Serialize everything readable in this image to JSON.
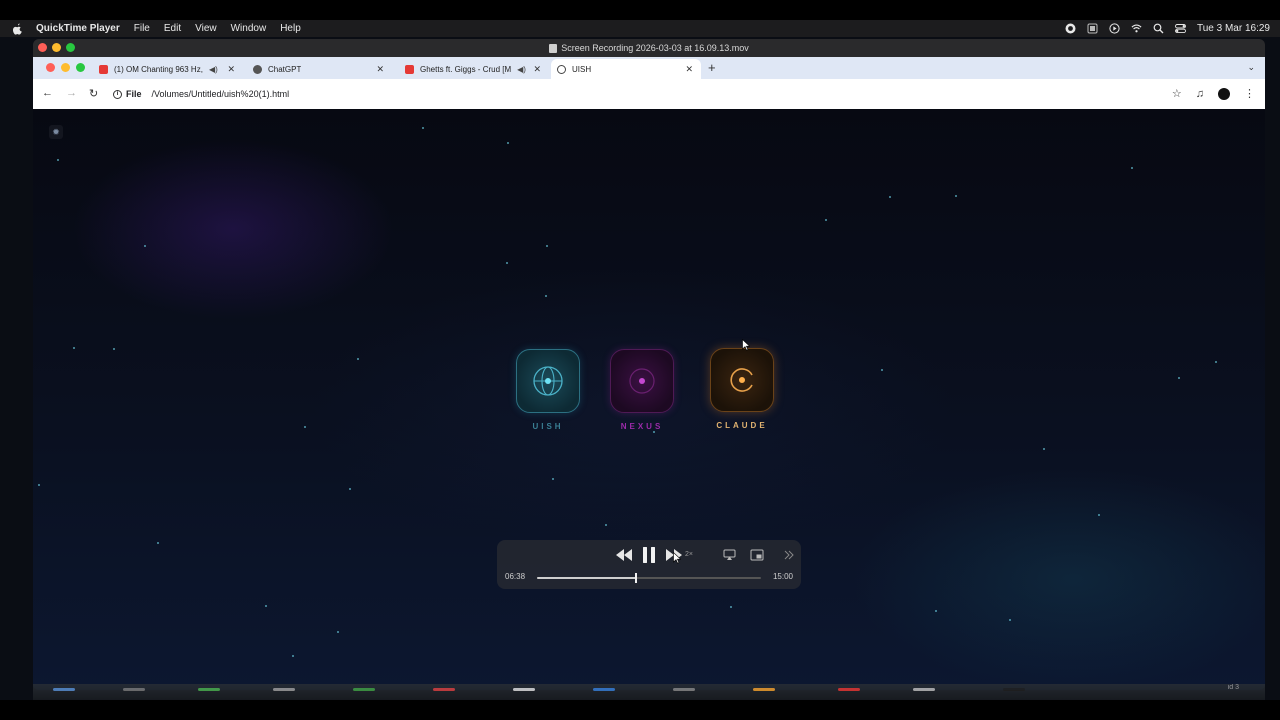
{
  "menubar": {
    "app_name": "QuickTime Player",
    "items": [
      "File",
      "Edit",
      "View",
      "Window",
      "Help"
    ],
    "datetime": "Tue 3 Mar  16:29"
  },
  "quicktime": {
    "title": "Screen Recording 2026-03-03 at 16.09.13.mov"
  },
  "browser": {
    "tabs": [
      {
        "title": "(1) OM Chanting 963 Hz,",
        "favicon": "youtube-icon",
        "has_audio": true
      },
      {
        "title": "ChatGPT",
        "favicon": "chatgpt-icon",
        "has_audio": false
      },
      {
        "title": "Ghetts ft. Giggs - Crud [M",
        "favicon": "youtube-icon",
        "has_audio": true
      },
      {
        "title": "UISH",
        "favicon": "globe-icon",
        "has_audio": false,
        "active": true
      }
    ],
    "address": {
      "chip": "File",
      "url": "/Volumes/Untitled/uish%20(1).html"
    }
  },
  "page": {
    "apps": [
      {
        "label": "UISH",
        "color": "#3a7f94"
      },
      {
        "label": "NEXUS",
        "color": "#9a2aa8"
      },
      {
        "label": "CLAUDE",
        "color": "#e0b270"
      }
    ]
  },
  "player": {
    "current_time": "06:38",
    "total_time": "15:00",
    "progress": 0.442,
    "speed_label": "2×"
  },
  "dock": {
    "label_line": "id 3"
  }
}
